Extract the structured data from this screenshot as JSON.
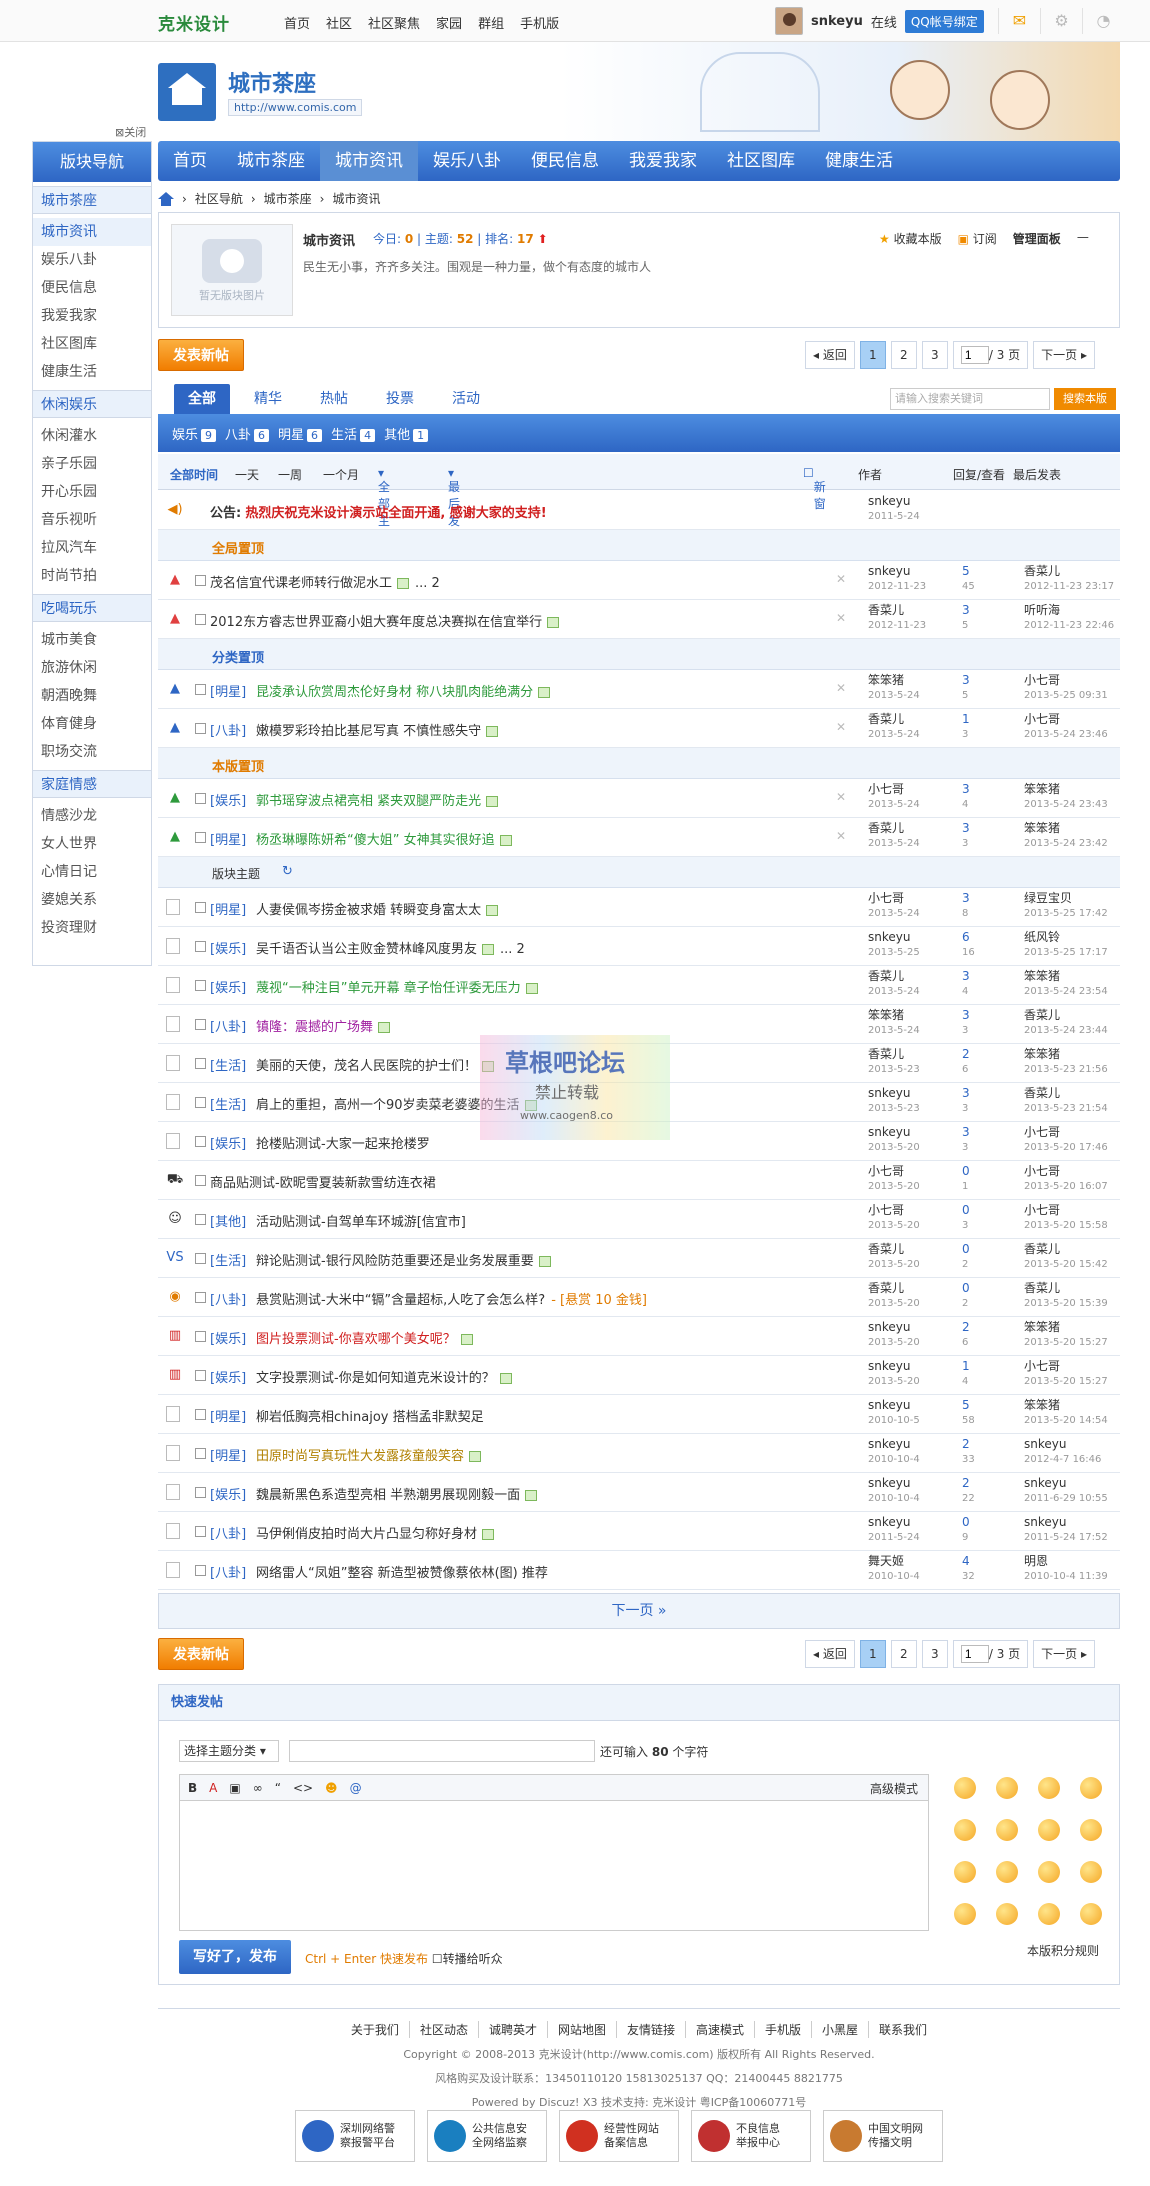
{
  "topbar": {
    "logo": "克米设计",
    "nav": [
      "首页",
      "社区",
      "社区聚焦",
      "家园",
      "群组",
      "手机版"
    ],
    "username": "snkeyu",
    "online": "在线",
    "qq_bind": "QQ帐号绑定"
  },
  "header": {
    "forum_name": "城市茶座",
    "forum_url": "http://www.comis.com",
    "close_sidebar": "关闭"
  },
  "mainnav": [
    "首页",
    "城市茶座",
    "城市资讯",
    "娱乐八卦",
    "便民信息",
    "我爱我家",
    "社区图库",
    "健康生活"
  ],
  "sidebar": {
    "title": "版块导航",
    "groups": [
      {
        "name": "城市茶座",
        "items": [
          "城市资讯",
          "娱乐八卦",
          "便民信息",
          "我爱我家",
          "社区图库",
          "健康生活"
        ]
      },
      {
        "name": "休闲娱乐",
        "items": [
          "休闲灌水",
          "亲子乐园",
          "开心乐园",
          "音乐视听",
          "拉风汽车",
          "时尚节拍"
        ]
      },
      {
        "name": "吃喝玩乐",
        "items": [
          "城市美食",
          "旅游休闲",
          "朝酒晚舞",
          "体育健身",
          "职场交流"
        ]
      },
      {
        "name": "家庭情感",
        "items": [
          "情感沙龙",
          "女人世界",
          "心情日记",
          "婆媳关系",
          "投资理财"
        ]
      }
    ]
  },
  "breadcrumb": [
    "社区导航",
    "城市茶座",
    "城市资讯"
  ],
  "forum": {
    "title": "城市资讯",
    "today_label": "今日:",
    "today": "0",
    "threads_label": "主题:",
    "threads": "52",
    "rank_label": "排名:",
    "rank": "17",
    "desc": "民生无小事，齐齐多关注。围观是一种力量，做个有态度的城市人",
    "no_icon": "暂无版块图片",
    "favorite": "收藏本版",
    "subscribe": "订阅",
    "manage": "管理面板"
  },
  "actions": {
    "post_new": "发表新帖",
    "back": "返回",
    "pages": [
      "1",
      "2",
      "3"
    ],
    "page_input": "1",
    "total_pages": "/ 3 页",
    "next": "下一页"
  },
  "tabs": [
    "全部",
    "精华",
    "热帖",
    "投票",
    "活动"
  ],
  "search": {
    "placeholder": "请输入搜索关键词",
    "button": "搜索本版"
  },
  "types": [
    {
      "name": "娱乐",
      "n": "9"
    },
    {
      "name": "八卦",
      "n": "6"
    },
    {
      "name": "明星",
      "n": "6"
    },
    {
      "name": "生活",
      "n": "4"
    },
    {
      "name": "其他",
      "n": "1"
    }
  ],
  "filters": {
    "all_time": "全部时间",
    "day": "一天",
    "week": "一周",
    "month": "一个月",
    "all_threads": "全部主题",
    "latest": "最后发表",
    "new_window": "新窗",
    "author": "作者",
    "replies": "回复/查看",
    "last": "最后发表"
  },
  "announcement": {
    "label": "公告:",
    "text": "热烈庆祝克米设计演示站全面开通, 感谢大家的支持!",
    "author": "snkeyu",
    "date": "2011-5-24"
  },
  "sections": {
    "global": "全局置顶",
    "category": "分类置顶",
    "forum": "本版置顶",
    "normal": "版块主题"
  },
  "threads": [
    {
      "sec": "global",
      "cat": "",
      "title": "茂名信宜代课老师转行做泥水工",
      "extra": "... 2",
      "author": "snkeyu",
      "adate": "2012-11-23",
      "rep": "5",
      "view": "45",
      "last": "香菜儿",
      "ldate": "2012-11-23 23:17"
    },
    {
      "sec": "global",
      "cat": "",
      "title": "2012东方睿志世界亚裔小姐大赛年度总决赛拟在信宜举行",
      "extra": "",
      "author": "香菜儿",
      "adate": "2012-11-23",
      "rep": "3",
      "view": "5",
      "last": "听听海",
      "ldate": "2012-11-23 22:46"
    },
    {
      "sec": "category",
      "cat": "[明星]",
      "title": "昆凌承认欣赏周杰伦好身材 称八块肌肉能绝满分",
      "extra": "",
      "author": "笨笨猪",
      "adate": "2013-5-24",
      "rep": "3",
      "view": "5",
      "last": "小七哥",
      "ldate": "2013-5-25 09:31"
    },
    {
      "sec": "category",
      "cat": "[八卦]",
      "title": "嫩模罗彩玲拍比基尼写真 不慎性感失守",
      "extra": "",
      "author": "香菜儿",
      "adate": "2013-5-24",
      "rep": "1",
      "view": "3",
      "last": "小七哥",
      "ldate": "2013-5-24 23:46"
    },
    {
      "sec": "forum",
      "cat": "[娱乐]",
      "title": "郭书瑶穿波点裙亮相 紧夹双腿严防走光",
      "extra": "",
      "author": "小七哥",
      "adate": "2013-5-24",
      "rep": "3",
      "view": "4",
      "last": "笨笨猪",
      "ldate": "2013-5-24 23:43"
    },
    {
      "sec": "forum",
      "cat": "[明星]",
      "title": "杨丞琳曝陈妍希“傻大姐” 女神其实很好追",
      "extra": "",
      "author": "香菜儿",
      "adate": "2013-5-24",
      "rep": "3",
      "view": "3",
      "last": "笨笨猪",
      "ldate": "2013-5-24 23:42"
    },
    {
      "sec": "normal",
      "cat": "[明星]",
      "title": "人妻侯佩岑捞金被求婚 转瞬变身富太太",
      "extra": "",
      "author": "小七哥",
      "adate": "2013-5-24",
      "rep": "3",
      "view": "8",
      "last": "绿豆宝贝",
      "ldate": "2013-5-25 17:42"
    },
    {
      "sec": "normal",
      "cat": "[娱乐]",
      "title": "吴千语否认当公主败金赞林峰风度男友",
      "extra": "... 2",
      "author": "snkeyu",
      "adate": "2013-5-25",
      "rep": "6",
      "view": "16",
      "last": "纸风铃",
      "ldate": "2013-5-25 17:17"
    },
    {
      "sec": "normal",
      "cat": "[娱乐]",
      "title": "蔑视“一种注目”单元开幕 章子怡任评委无压力",
      "extra": "",
      "author": "香菜儿",
      "adate": "2013-5-24",
      "rep": "3",
      "view": "4",
      "last": "笨笨猪",
      "ldate": "2013-5-24 23:54"
    },
    {
      "sec": "normal",
      "cat": "[八卦]",
      "title": "镇隆：震撼的广场舞",
      "extra": "",
      "author": "笨笨猪",
      "adate": "2013-5-24",
      "rep": "3",
      "view": "3",
      "last": "香菜儿",
      "ldate": "2013-5-24 23:44"
    },
    {
      "sec": "normal",
      "cat": "[生活]",
      "title": "美丽的天使，茂名人民医院的护士们！",
      "extra": "",
      "author": "香菜儿",
      "adate": "2013-5-23",
      "rep": "2",
      "view": "6",
      "last": "笨笨猪",
      "ldate": "2013-5-23 21:56"
    },
    {
      "sec": "normal",
      "cat": "[生活]",
      "title": "肩上的重担，高州一个90岁卖菜老婆婆的生活",
      "extra": "",
      "author": "snkeyu",
      "adate": "2013-5-23",
      "rep": "3",
      "view": "3",
      "last": "香菜儿",
      "ldate": "2013-5-23 21:54"
    },
    {
      "sec": "normal",
      "cat": "[娱乐]",
      "title": "抢楼贴测试-大家一起来抢楼罗",
      "extra": "",
      "author": "snkeyu",
      "adate": "2013-5-20",
      "rep": "3",
      "view": "3",
      "last": "小七哥",
      "ldate": "2013-5-20 17:46"
    },
    {
      "sec": "normal",
      "cat": "",
      "title": "商品贴测试-欧昵雪夏装新款雪纺连衣裙",
      "extra": "",
      "author": "小七哥",
      "adate": "2013-5-20",
      "rep": "0",
      "view": "1",
      "last": "小七哥",
      "ldate": "2013-5-20 16:07"
    },
    {
      "sec": "normal",
      "cat": "[其他]",
      "title": "活动贴测试-自驾单车环城游[信宜市]",
      "extra": "",
      "author": "小七哥",
      "adate": "2013-5-20",
      "rep": "0",
      "view": "3",
      "last": "小七哥",
      "ldate": "2013-5-20 15:58"
    },
    {
      "sec": "normal",
      "cat": "[生活]",
      "title": "辩论贴测试-银行风险防范重要还是业务发展重要",
      "extra": "",
      "author": "香菜儿",
      "adate": "2013-5-20",
      "rep": "0",
      "view": "2",
      "last": "香菜儿",
      "ldate": "2013-5-20 15:42"
    },
    {
      "sec": "normal",
      "cat": "[八卦]",
      "title": "悬赏贴测试-大米中“镉”含量超标,人吃了会怎么样?",
      "extra": "- [悬赏 10 金钱]",
      "author": "香菜儿",
      "adate": "2013-5-20",
      "rep": "0",
      "view": "2",
      "last": "香菜儿",
      "ldate": "2013-5-20 15:39"
    },
    {
      "sec": "normal",
      "cat": "[娱乐]",
      "title": "图片投票测试-你喜欢哪个美女呢？",
      "extra": "",
      "author": "snkeyu",
      "adate": "2013-5-20",
      "rep": "2",
      "view": "6",
      "last": "笨笨猪",
      "ldate": "2013-5-20 15:27"
    },
    {
      "sec": "normal",
      "cat": "[娱乐]",
      "title": "文字投票测试-你是如何知道克米设计的？",
      "extra": "",
      "author": "snkeyu",
      "adate": "2013-5-20",
      "rep": "1",
      "view": "4",
      "last": "小七哥",
      "ldate": "2013-5-20 15:27"
    },
    {
      "sec": "normal",
      "cat": "[明星]",
      "title": "柳岩低胸亮相chinajoy 搭档孟非默契足",
      "extra": "",
      "author": "snkeyu",
      "adate": "2010-10-5",
      "rep": "5",
      "view": "58",
      "last": "笨笨猪",
      "ldate": "2013-5-20 14:54"
    },
    {
      "sec": "normal",
      "cat": "[明星]",
      "title": "田原时尚写真玩性大发露孩童般笑容",
      "extra": "",
      "author": "snkeyu",
      "adate": "2010-10-4",
      "rep": "2",
      "view": "33",
      "last": "snkeyu",
      "ldate": "2012-4-7 16:46"
    },
    {
      "sec": "normal",
      "cat": "[娱乐]",
      "title": "魏晨新黑色系造型亮相 半熟潮男展现刚毅一面",
      "extra": "",
      "author": "snkeyu",
      "adate": "2010-10-4",
      "rep": "2",
      "view": "22",
      "last": "snkeyu",
      "ldate": "2011-6-29 10:55"
    },
    {
      "sec": "normal",
      "cat": "[八卦]",
      "title": "马伊俐俏皮拍时尚大片凸显匀称好身材",
      "extra": "",
      "author": "snkeyu",
      "adate": "2011-5-24",
      "rep": "0",
      "view": "9",
      "last": "snkeyu",
      "ldate": "2011-5-24 17:52"
    },
    {
      "sec": "normal",
      "cat": "[八卦]",
      "title": "网络雷人“凤姐”整容 新造型被赞像蔡依林(图) 推荐",
      "extra": "",
      "author": "舞天姬",
      "adate": "2010-10-4",
      "rep": "4",
      "view": "32",
      "last": "明恩",
      "ldate": "2010-10-4 11:39"
    }
  ],
  "nextpage": "下一页 »",
  "quickpost": {
    "title": "快速发帖",
    "select": "选择主题分类",
    "remain": "还可输入",
    "remain_n": "80",
    "remain_unit": "个字符",
    "advanced": "高级模式",
    "submit": "写好了，发布",
    "ctrl": "Ctrl + Enter 快速发布",
    "broadcast": "转播给听众",
    "rules": "本版积分规则"
  },
  "watermark": {
    "line1": "草根吧论坛",
    "line2": "禁止转载",
    "line3": "www.caogen8.co"
  },
  "footer": {
    "links": [
      "关于我们",
      "社区动态",
      "诚聘英才",
      "网站地图",
      "友情链接",
      "高速模式",
      "手机版",
      "小黑屋",
      "联系我们"
    ],
    "copyright": "Copyright © 2008-2013 克米设计(http://www.comis.com) 版权所有 All Rights Reserved.",
    "contact": "风格购买及设计联系：13450110120 15813025137 QQ：21400445 8821775",
    "powered": "Powered by Discuz! X3  技术支持: 克米设计 粤ICP备10060771号",
    "badges": [
      [
        "深圳网络警",
        "察报警平台"
      ],
      [
        "公共信息安",
        "全网络监察"
      ],
      [
        "经营性网站",
        "备案信息"
      ],
      [
        "不良信息",
        "举报中心"
      ],
      [
        "中国文明网",
        "传播文明"
      ]
    ]
  }
}
